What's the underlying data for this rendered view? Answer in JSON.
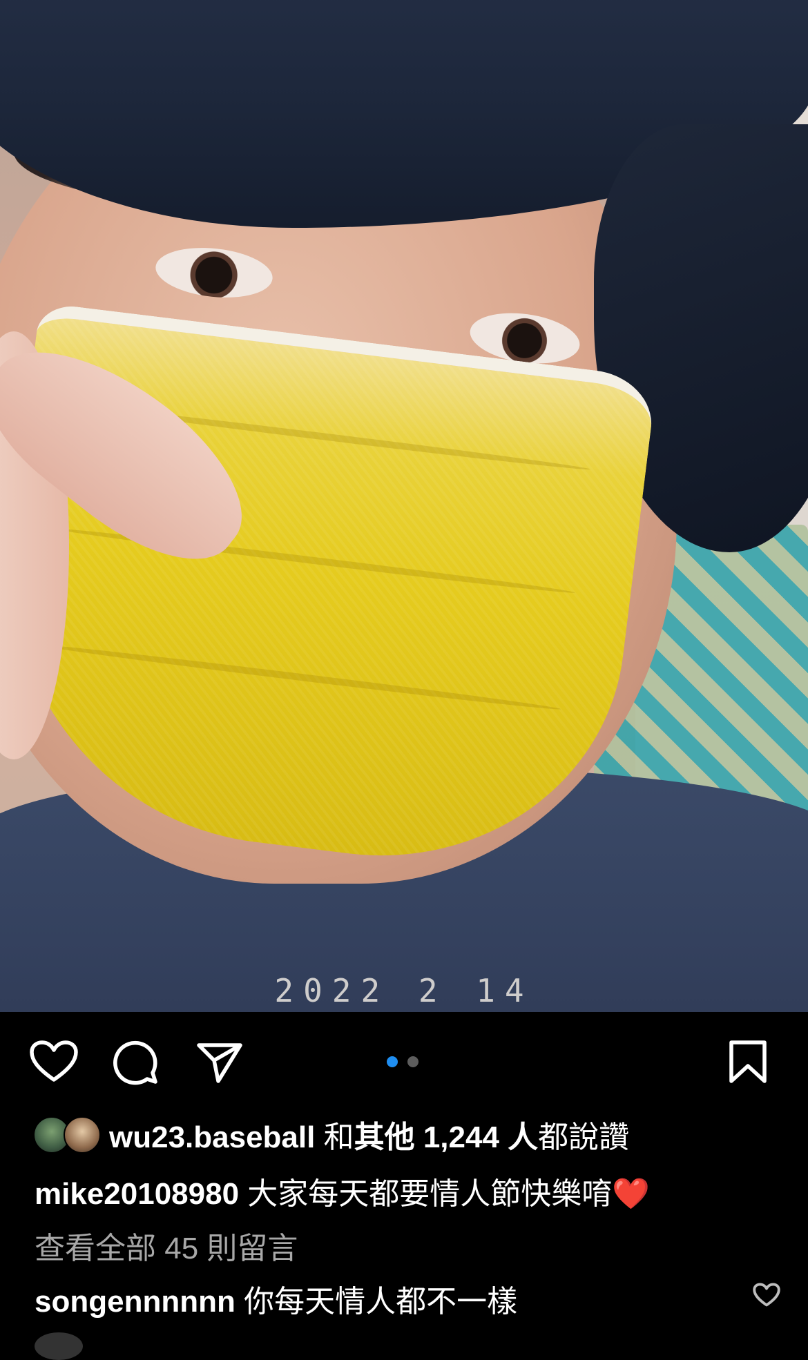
{
  "photo": {
    "date_stamp": "2022  2  14",
    "carousel": {
      "count": 2,
      "active_index": 0
    }
  },
  "actions": {
    "like_icon": "heart-icon",
    "comment_icon": "comment-bubble-icon",
    "share_icon": "paper-plane-icon",
    "save_icon": "bookmark-icon"
  },
  "likes": {
    "username": "wu23.baseball",
    "text_and": "和",
    "text_others": "其他 1,244 人",
    "text_suffix": "都說讚"
  },
  "caption": {
    "username": "mike20108980",
    "text": "大家每天都要情人節快樂唷",
    "emoji": "❤️"
  },
  "view_all_comments": "查看全部 45 則留言",
  "comment": {
    "username": "songennnnnn",
    "text": "你每天情人都不一樣"
  },
  "colors": {
    "background": "#000000",
    "text": "#ffffff",
    "muted": "#a8a8a8",
    "active_dot": "#1f8ef1",
    "inactive_dot": "#5d5d5d"
  }
}
